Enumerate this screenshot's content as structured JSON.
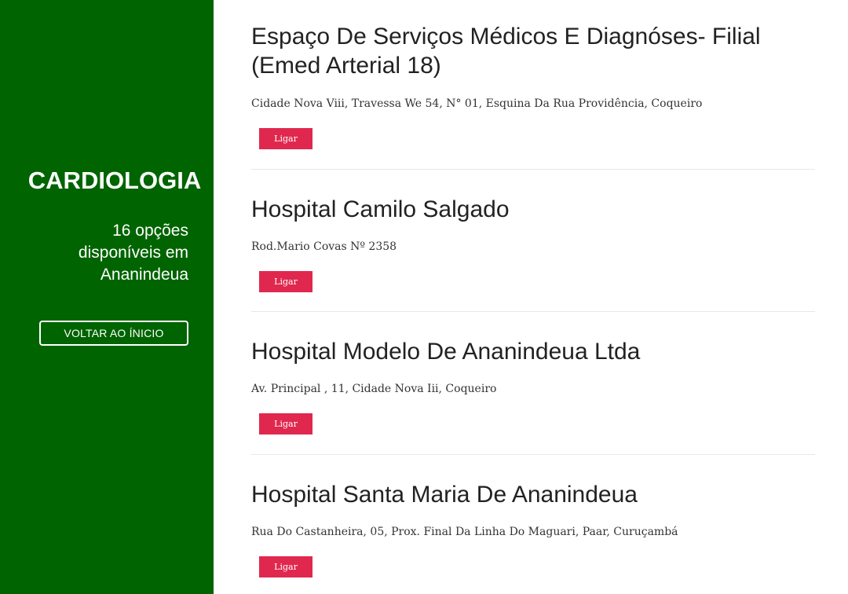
{
  "sidebar": {
    "specialty": "CARDIOLOGIA",
    "options_line1": "16 opções",
    "options_line2": "disponíveis em",
    "options_line3": "Ananindeua",
    "back_label": "VOLTAR AO ÍNICIO"
  },
  "listings": [
    {
      "name_line1": "Espaço De Serviços Médicos E Diagnóses- Filial",
      "name_line2": "(Emed Arterial 18)",
      "address": "Cidade Nova Viii, Travessa We 54, N° 01, Esquina Da Rua Providência, Coqueiro",
      "call_label": "Ligar"
    },
    {
      "name_line1": "Hospital Camilo Salgado",
      "address": "Rod.Mario Covas Nº 2358",
      "call_label": "Ligar"
    },
    {
      "name_line1": "Hospital Modelo De Ananindeua Ltda",
      "address": "Av. Principal , 11, Cidade Nova Iii, Coqueiro",
      "call_label": "Ligar"
    },
    {
      "name_line1": "Hospital Santa Maria De Ananindeua",
      "address": "Rua Do Castanheira, 05, Prox. Final Da Linha Do Maguari, Paar, Curuçambá",
      "call_label": "Ligar"
    }
  ],
  "colors": {
    "sidebar_bg": "#006400",
    "call_button_bg": "#e0284f"
  }
}
